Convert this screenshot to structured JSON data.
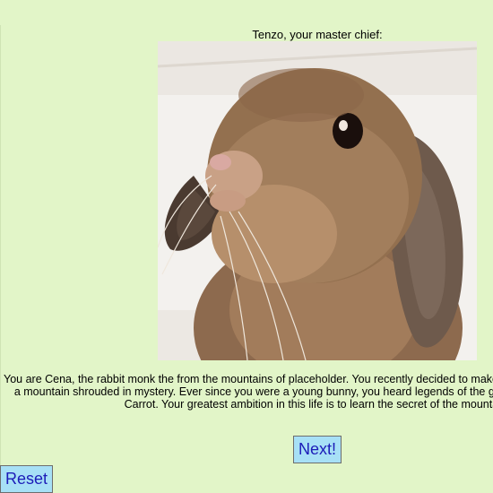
{
  "master": {
    "caption": "Tenzo, your master chief:"
  },
  "story": {
    "text": "You are Cena, the rabbit monk the from the mountains of placeholder. You recently decided to make a pilgrimage to Mt. Carrot, a mountain shrouded in mystery. Ever since you were a young bunny, you heard legends of the great spiritual power of Mt. Carrot. Your greatest ambition in this life is to learn the secret of the mountain."
  },
  "buttons": {
    "next_label": "Next!",
    "reset_label": "Reset"
  },
  "colors": {
    "background": "#e2f5c8",
    "button_bg": "#a7e0f6",
    "button_text": "#1c1cb8"
  }
}
